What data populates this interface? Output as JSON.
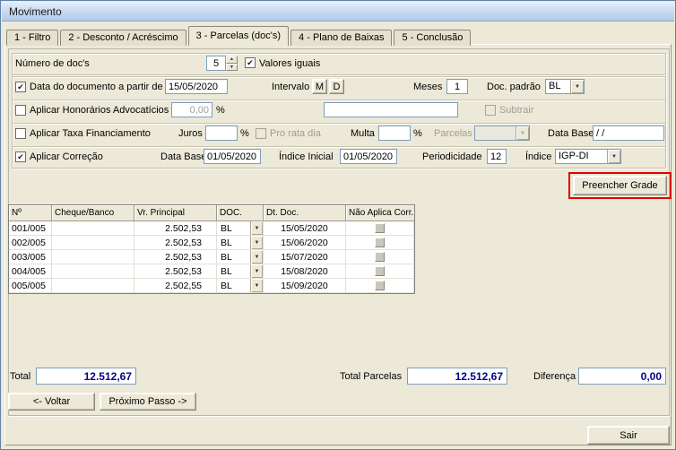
{
  "window": {
    "title": "Movimento"
  },
  "tabs": [
    {
      "label": "1 - Filtro"
    },
    {
      "label": "2 - Desconto / Acréscimo"
    },
    {
      "label": "3 - Parcelas (doc's)"
    },
    {
      "label": "4 - Plano de Baixas"
    },
    {
      "label": "5 - Conclusão"
    }
  ],
  "icons": {
    "dropdown": "▼",
    "spin_up": "▲",
    "spin_down": "▼",
    "check": "✔"
  },
  "form": {
    "num_docs": {
      "label": "Número de doc's",
      "value": "5",
      "valores_iguais_label": "Valores iguais",
      "valores_iguais_checked": true
    },
    "data_doc": {
      "checked": true,
      "label": "Data do documento a partir de",
      "value": "15/05/2020",
      "intervalo_label": "Intervalo",
      "m_label": "M",
      "d_label": "D",
      "meses_label": "Meses",
      "meses_value": "1",
      "doc_padrao_label": "Doc. padrão",
      "doc_padrao_value": "BL"
    },
    "honorarios": {
      "checked": false,
      "label": "Aplicar Honorários Advocatícios",
      "value": "0,00",
      "percent": "%",
      "extra_value": "",
      "subtrair_label": "Subtrair",
      "subtrair_checked": false
    },
    "taxa": {
      "checked": false,
      "label": "Aplicar Taxa Financiamento",
      "juros_label": "Juros",
      "juros_value": "",
      "percent1": "%",
      "pro_rata_label": "Pro rata dia",
      "pro_rata_checked": false,
      "multa_label": "Multa",
      "multa_value": "",
      "percent2": "%",
      "parcelas_label": "Parcelas",
      "data_base_label": "Data Base",
      "data_base_value": "/ /"
    },
    "correcao": {
      "checked": true,
      "label": "Aplicar Correção",
      "data_base_label": "Data Base",
      "data_base_value": "01/05/2020",
      "indice_inicial_label": "Índice Inicial",
      "indice_inicial_value": "01/05/2020",
      "periodicidade_label": "Periodicidade",
      "periodicidade_value": "12",
      "indice_label": "Índice",
      "indice_value": "IGP-DI"
    },
    "preencher_grade_label": "Preencher Grade"
  },
  "grid": {
    "columns": [
      "Nº",
      "Cheque/Banco",
      "Vr. Principal",
      "DOC.",
      "Dt. Doc.",
      "Não Aplica Corr."
    ],
    "rows": [
      {
        "numero": "001/005",
        "cheque_banco": "",
        "vr_principal": "2.502,53",
        "doc": "BL",
        "dt_doc": "15/05/2020"
      },
      {
        "numero": "002/005",
        "cheque_banco": "",
        "vr_principal": "2.502,53",
        "doc": "BL",
        "dt_doc": "15/06/2020"
      },
      {
        "numero": "003/005",
        "cheque_banco": "",
        "vr_principal": "2.502,53",
        "doc": "BL",
        "dt_doc": "15/07/2020"
      },
      {
        "numero": "004/005",
        "cheque_banco": "",
        "vr_principal": "2.502,53",
        "doc": "BL",
        "dt_doc": "15/08/2020"
      },
      {
        "numero": "005/005",
        "cheque_banco": "",
        "vr_principal": "2.502,55",
        "doc": "BL",
        "dt_doc": "15/09/2020"
      }
    ]
  },
  "totals": {
    "total_label": "Total",
    "total_value": "12.512,67",
    "total_parcelas_label": "Total Parcelas",
    "total_parcelas_value": "12.512,67",
    "diferenca_label": "Diferença",
    "diferenca_value": "0,00"
  },
  "nav": {
    "voltar_label": "<- Voltar",
    "proximo_label": "Próximo Passo ->",
    "sair_label": "Sair"
  },
  "annotation": {
    "color": "#e20000"
  }
}
